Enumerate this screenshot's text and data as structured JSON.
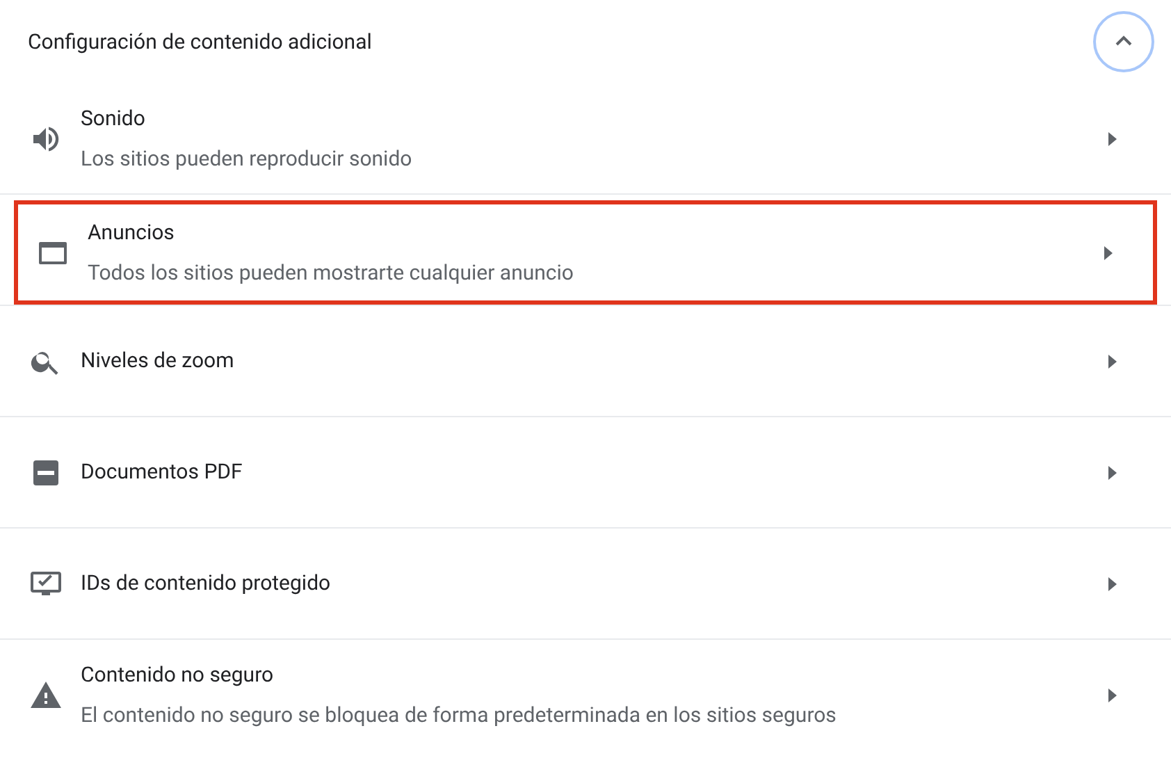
{
  "section": {
    "title": "Configuración de contenido adicional",
    "expanded": true
  },
  "items": [
    {
      "kind": "sound",
      "title": "Sonido",
      "subtitle": "Los sitios pueden reproducir sonido",
      "highlighted": false
    },
    {
      "kind": "ads",
      "title": "Anuncios",
      "subtitle": "Todos los sitios pueden mostrarte cualquier anuncio",
      "highlighted": true
    },
    {
      "kind": "zoom",
      "title": "Niveles de zoom",
      "highlighted": false
    },
    {
      "kind": "pdf",
      "title": "Documentos PDF",
      "highlighted": false
    },
    {
      "kind": "protected",
      "title": "IDs de contenido protegido",
      "highlighted": false
    },
    {
      "kind": "insecure",
      "title": "Contenido no seguro",
      "subtitle": "El contenido no seguro se bloquea de forma predeterminada en los sitios seguros",
      "highlighted": false
    }
  ]
}
